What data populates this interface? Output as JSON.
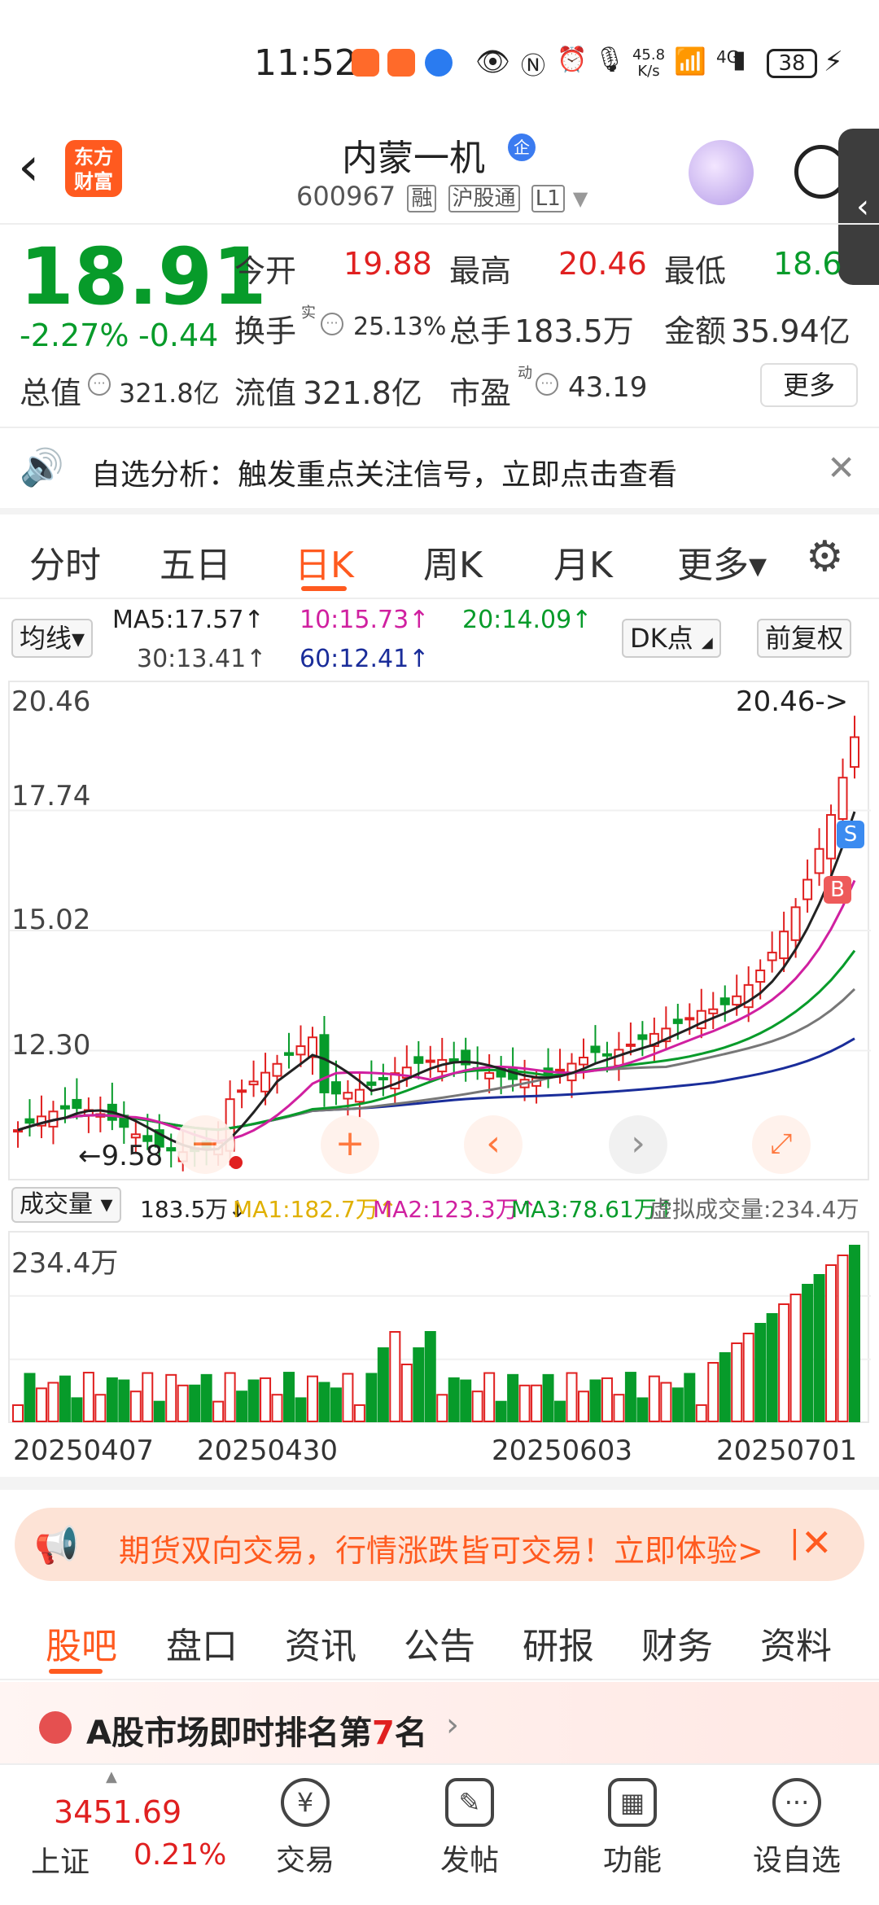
{
  "status_bar": {
    "time": "11:52",
    "net_speed": "45.8 K/s",
    "network": "4G",
    "battery": "38",
    "icons": [
      "app-icon",
      "app-icon",
      "app-icon",
      "eye-icon",
      "nfc-icon",
      "alarm-icon",
      "mic-icon",
      "wifi-icon",
      "signal-icon",
      "charging-icon"
    ]
  },
  "header": {
    "back_icon": "chevron-left-icon",
    "logo_text": "东方\n财富",
    "stock_name": "内蒙一机",
    "qi_badge": "企",
    "code": "600967",
    "tags": [
      "融",
      "沪股通",
      "L1"
    ],
    "side_tab_icon": "chevron-left-icon"
  },
  "quote": {
    "price": "18.91",
    "change_pct": "-2.27%",
    "change_abs": "-0.44",
    "open_label": "今开",
    "open": "19.88",
    "high_label": "最高",
    "high": "20.46",
    "low_label": "最低",
    "low": "18.6",
    "turnover_label": "换手",
    "turnover_sup": "实",
    "turnover": "25.13%",
    "volume_label": "总手",
    "volume": "183.5万",
    "amount_label": "金额",
    "amount": "35.94亿",
    "mktcap_label": "总值",
    "mktcap": "321.8亿",
    "float_label": "流值",
    "float": "321.8亿",
    "pe_label": "市盈",
    "pe_sup": "动",
    "pe": "43.19",
    "more": "更多"
  },
  "notice": {
    "text": "自选分析：触发重点关注信号，立即点击查看"
  },
  "tabs": [
    "分时",
    "五日",
    "日K",
    "周K",
    "月K",
    "更多▾"
  ],
  "ma": {
    "chip": "均线▾",
    "ma5": "MA5:17.57↑",
    "ma10": "10:15.73↑",
    "ma20": "20:14.09↑",
    "ma30": "30:13.41↑",
    "ma60": "60:12.41↑",
    "dk": "DK点",
    "adjust": "前复权",
    "colors": {
      "ma5": "#222222",
      "ma10": "#d020a0",
      "ma20": "#079b2a",
      "ma30": "#777777",
      "ma60": "#1a2d9a"
    }
  },
  "chart_data": [
    {
      "type": "candlestick",
      "y_ticks": [
        "20.46",
        "17.74",
        "15.02",
        "12.30",
        "9.58"
      ],
      "ylim": [
        9.58,
        20.46
      ],
      "annotations": [
        "20.46->",
        "9.58",
        "S",
        "B"
      ],
      "ma5_last": 17.57,
      "ma10_last": 15.73,
      "ma20_last": 14.09,
      "ma30_last": 13.41,
      "ma60_last": 12.41
    },
    {
      "type": "bar",
      "title": "成交量",
      "y_max_label": "234.4万",
      "current": "183.5万↓",
      "ma1": "MA1:182.7万↑",
      "ma2": "MA2:123.3万↑",
      "ma3": "MA3:78.61万↑",
      "virtual": "虚拟成交量:234.4万",
      "x_ticks": [
        "20250407",
        "20250430",
        "20250603",
        "20250701"
      ]
    }
  ],
  "promo": {
    "text": "期货双向交易，行情涨跌皆可交易！立即体验>",
    "sep": "|"
  },
  "bottom_tabs": [
    "股吧",
    "盘口",
    "资讯",
    "公告",
    "研报",
    "财务",
    "资料"
  ],
  "rank": {
    "prefix": "A股市场即时排名第",
    "num": "7",
    "suffix": "名"
  },
  "bottom_nav": {
    "index_value": "3451.69",
    "index_name": "上证",
    "index_pct": "0.21%",
    "items": [
      "交易",
      "发帖",
      "功能",
      "设自选"
    ]
  }
}
